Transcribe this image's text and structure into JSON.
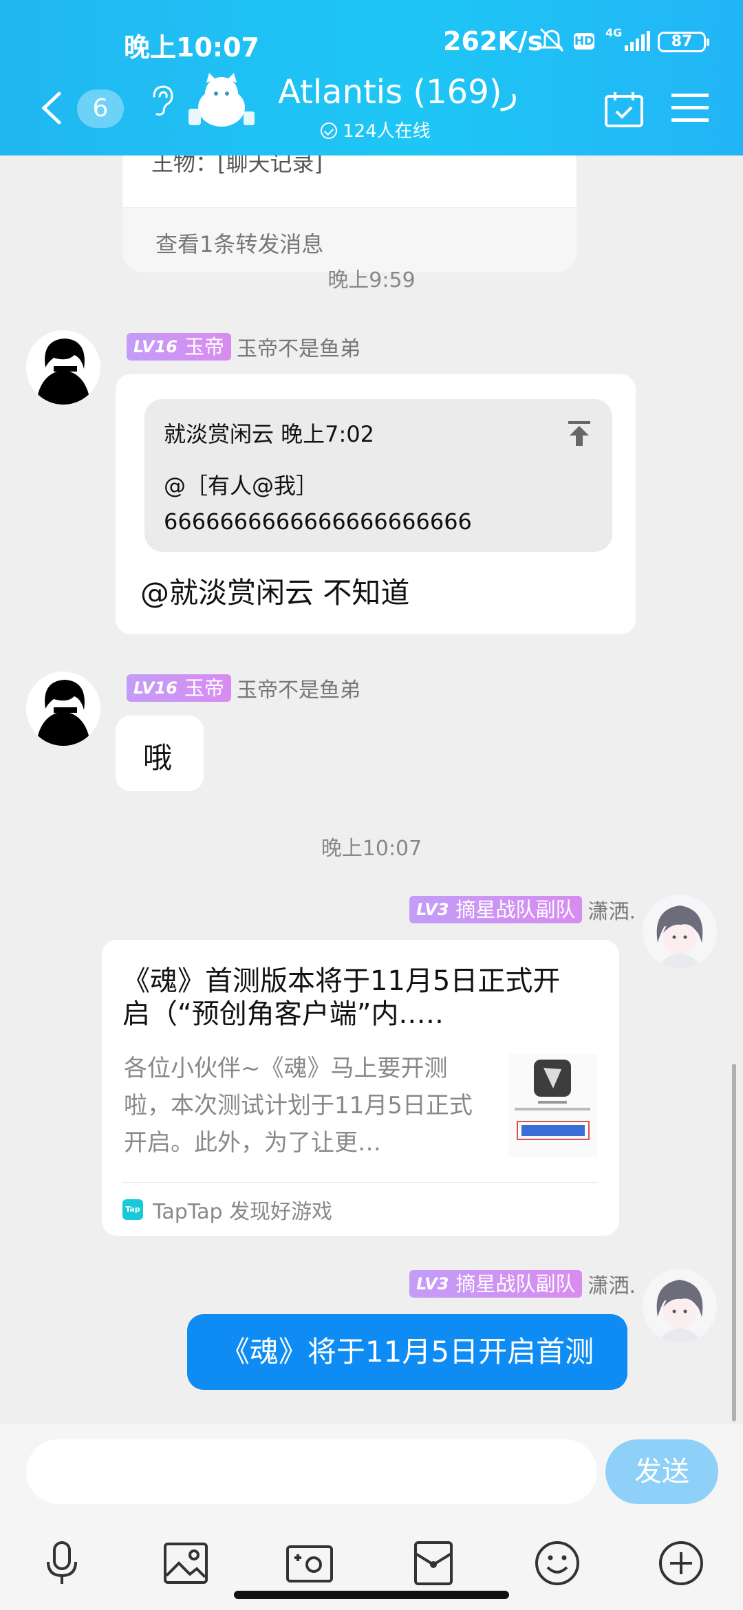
{
  "status_bar": {
    "time": "晚上10:07",
    "net_speed": "262K/s",
    "hd": "HD",
    "network": "4G",
    "battery": "87"
  },
  "header": {
    "unread_count": "6",
    "title": "Atlantis ر(169)",
    "online": "124人在线"
  },
  "forward_card": {
    "cut_text": "王物：[聊天记录]",
    "link": "查看1条转发消息"
  },
  "timestamps": [
    "晚上9:59",
    "晚上10:07"
  ],
  "messages": [
    {
      "level": "LV16",
      "title": "玉帝",
      "nickname": "玉帝不是鱼弟",
      "quote": {
        "header": "就淡赏闲云 晚上7:02",
        "line1": "@［有人@我］",
        "line2": "6666666666666666666666"
      },
      "text": "@就淡赏闲云 不知道"
    },
    {
      "level": "LV16",
      "title": "玉帝",
      "nickname": "玉帝不是鱼弟",
      "text": "哦"
    },
    {
      "level": "LV3",
      "title": "摘星战队副队",
      "nickname": "潇洒.",
      "card": {
        "title": "《魂》首测版本将于11月5日正式开启（“预创角客户端”内.….",
        "desc": "各位小伙伴~《魂》马上要开测啦，本次测试计划于11月5日正式开启。此外，为了让更…",
        "source": "TapTap 发现好游戏"
      }
    },
    {
      "level": "LV3",
      "title": "摘星战队副队",
      "nickname": "潇洒.",
      "text": "《魂》将于11月5日开启首测"
    }
  ],
  "input": {
    "placeholder": "",
    "send_label": "发送"
  },
  "toolbar": [
    "microphone-icon",
    "image-icon",
    "camera-icon",
    "red-packet-icon",
    "emoji-icon",
    "plus-icon"
  ],
  "colors": {
    "header_blue": "#21b7f2",
    "bubble_blue": "#0e8cf3",
    "badge_purple": "#c39cf7",
    "send_blue": "#8fd0f8"
  }
}
